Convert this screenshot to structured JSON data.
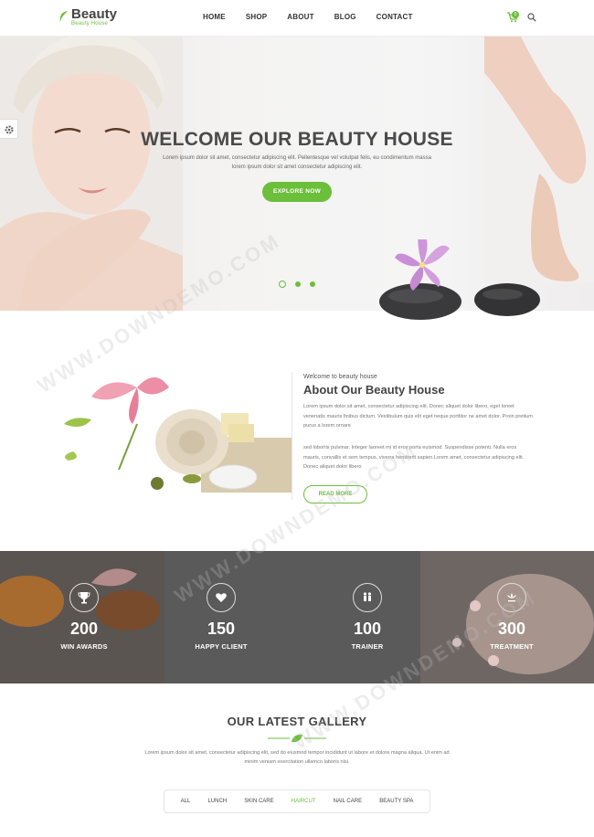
{
  "brand": {
    "name": "Beauty",
    "tagline": "Beauty House",
    "accent": "#6bbf3b"
  },
  "nav": [
    "HOME",
    "SHOP",
    "ABOUT",
    "BLOG",
    "CONTACT"
  ],
  "cart_count": "0",
  "hero": {
    "title": "WELCOME OUR BEAUTY HOUSE",
    "description": "Lorem ipsum dolor sit amet, consectetur adipiscing elit. Pellentesque vel volutpat felis, eu condimentum massa lorem ipsum dolor sit amet consectetur adipiscing elit.",
    "button": "EXPLORE NOW",
    "slides": 3
  },
  "about": {
    "kicker": "Welcome to beauty house",
    "title": "About Our Beauty House",
    "p1": "Lorem ipsum dolor sit amet, consectetur adipiscing elit. Donec aliquet dolor libero, eget loreet venenatis mauris finibus dictum. Vestibulum quis elit eget neque porttitor ne amet dolor. Proin pretium purus a lorem ornare",
    "p2": "sed lobortis pulvinar. Integer laoreet mi id eros porta euismod. Suspendisse potenti. Nulla eros mauris, convallis et sem tempus, viverra hendrerit sapien.Lorem amet, consectetur adipiscing elit. Donec aliquet dolor libero",
    "button": "READ MORE"
  },
  "stats": [
    {
      "icon": "trophy-icon",
      "number": "200",
      "label": "WIN AWARDS"
    },
    {
      "icon": "heart-icon",
      "number": "150",
      "label": "HAPPY CLIENT"
    },
    {
      "icon": "people-icon",
      "number": "100",
      "label": "TRAINER"
    },
    {
      "icon": "lotus-icon",
      "number": "300",
      "label": "TREATMENT"
    }
  ],
  "gallery": {
    "title": "OUR LATEST GALLERY",
    "description": "Lorem ipsum dolor sit amet, consectetur adipiscing elit, sed do eiusmod tempor incididunt ut labore et dolore magna aliqua. Ut enim ad minim veniam exercitation ullamco laboris nisi.",
    "filters": [
      "ALL",
      "LUNCH",
      "SKIN CARE",
      "HAIRCUT",
      "NAIL CARE",
      "BEAUTY SPA"
    ],
    "active_filter": "HAIRCUT"
  },
  "watermark": "WWW.DOWNDEMO.COM"
}
